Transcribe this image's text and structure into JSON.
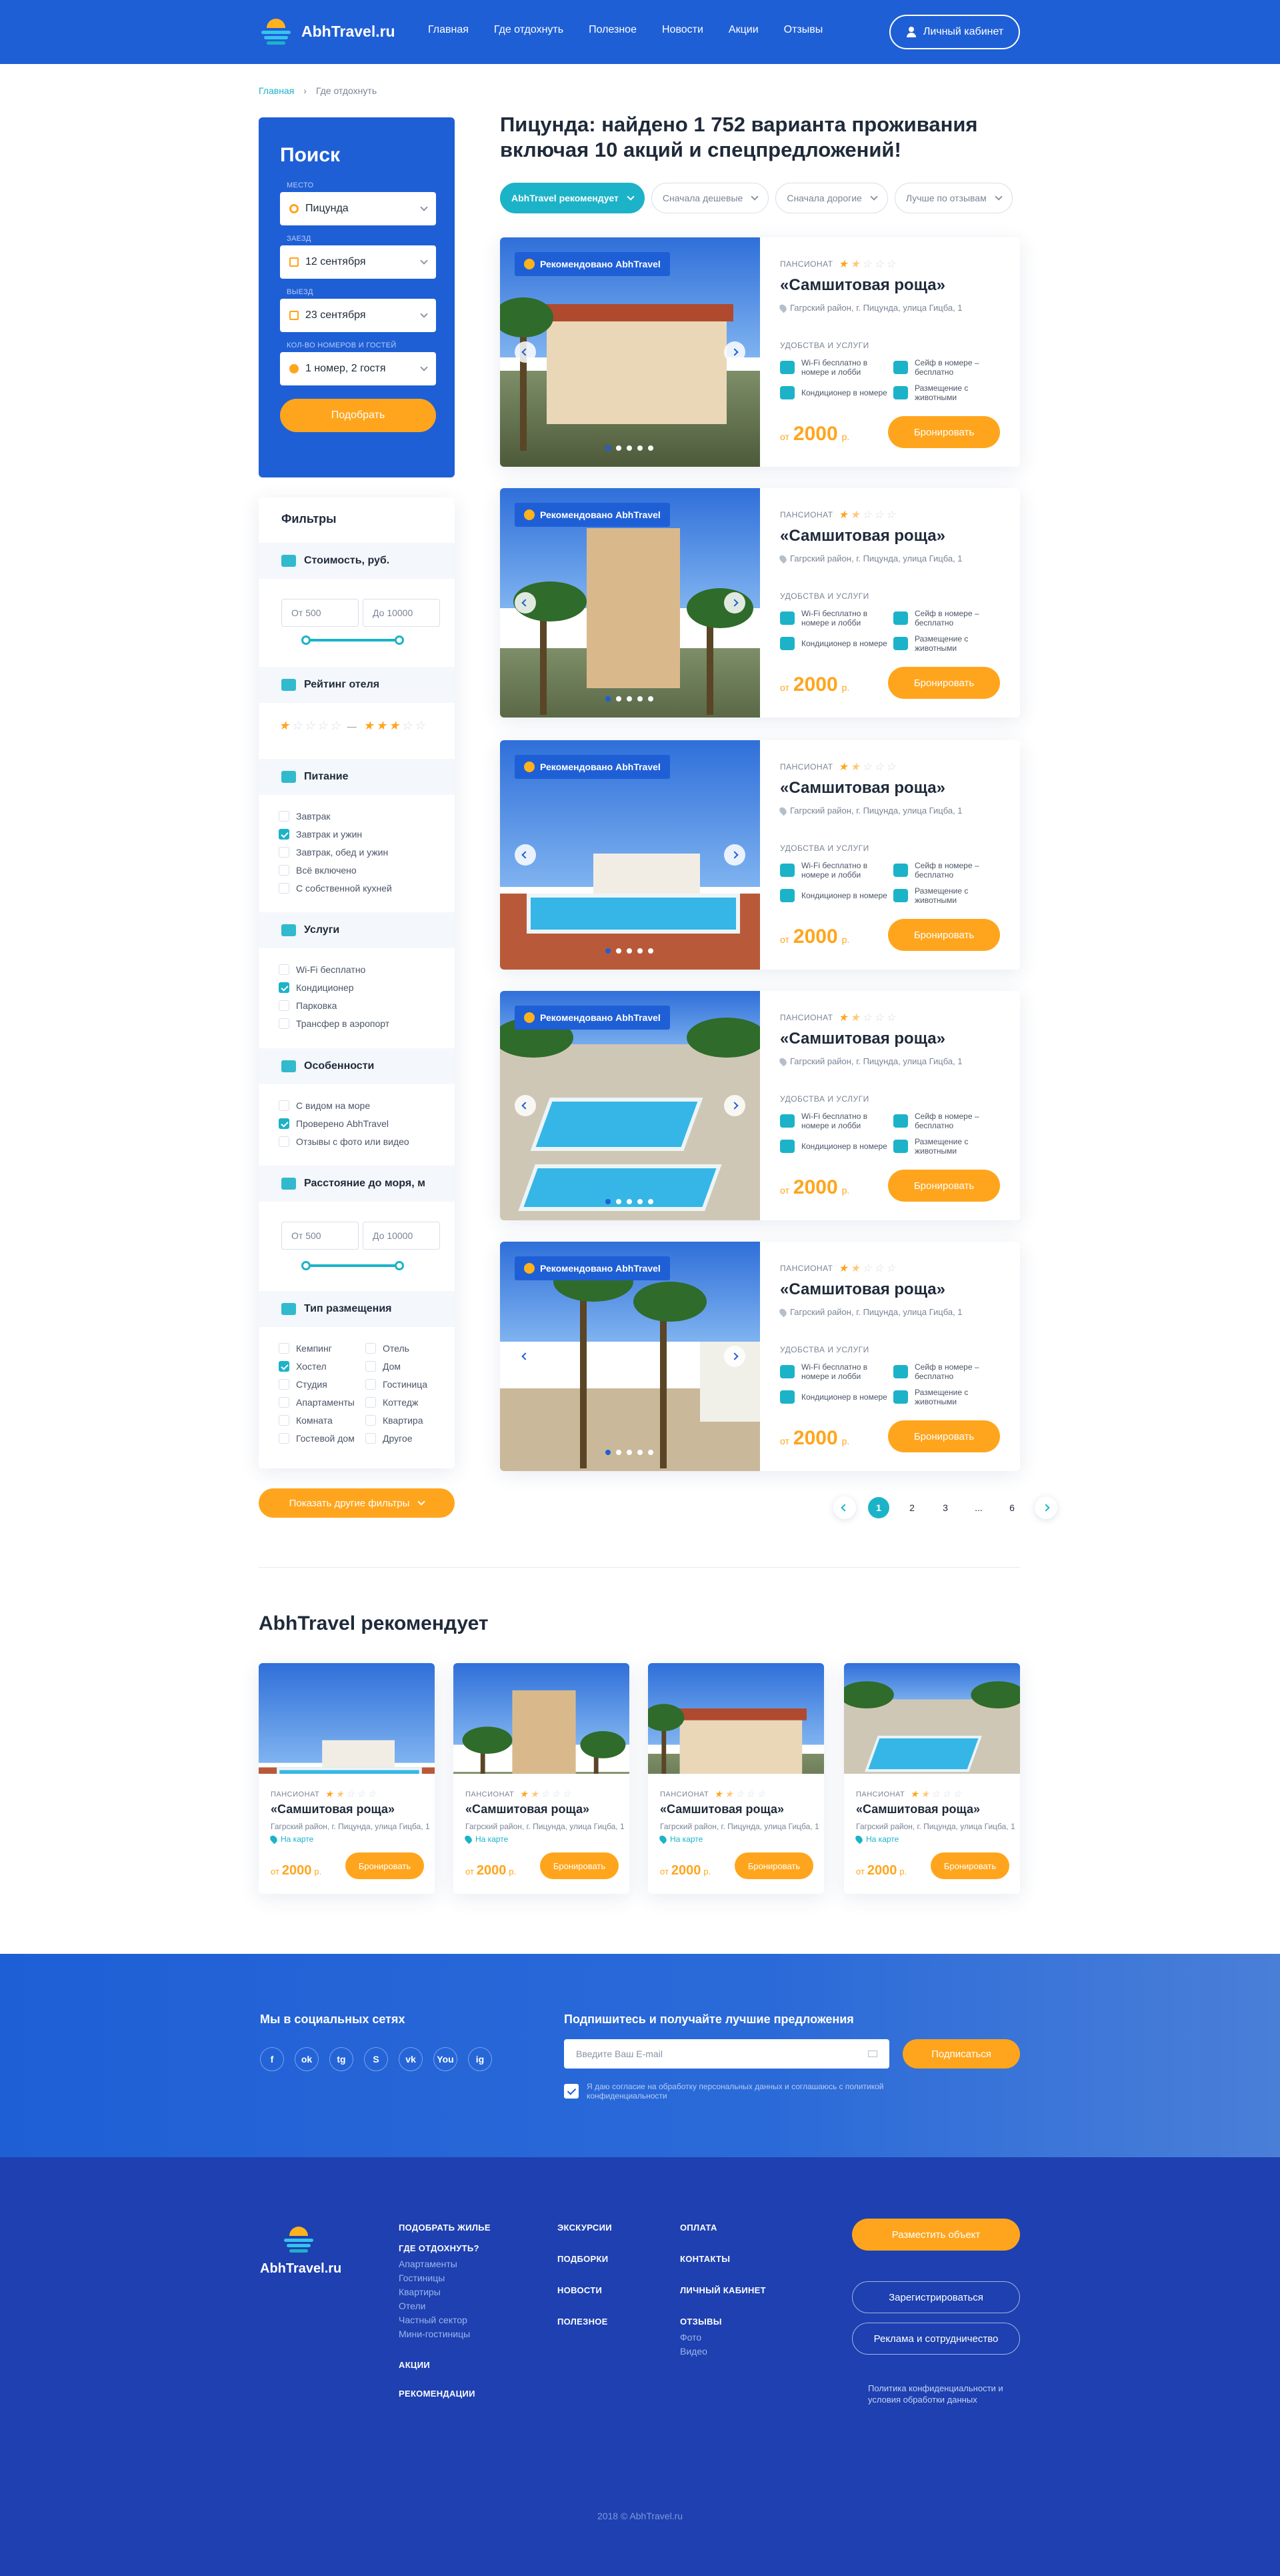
{
  "header": {
    "logo": "AbhTravel.ru",
    "nav": [
      "Главная",
      "Где отдохнуть",
      "Полезное",
      "Новости",
      "Акции",
      "Отзывы"
    ],
    "cabinet": "Личный кабинет"
  },
  "breadcrumb": [
    "Главная",
    "Где отдохнуть"
  ],
  "search": {
    "title": "Поиск",
    "fields": [
      {
        "label": "Место",
        "value": "Пицунда"
      },
      {
        "label": "Заезд",
        "value": "12 сентября"
      },
      {
        "label": "Выезд",
        "value": "23 сентября"
      },
      {
        "label": "Кол-во номеров и гостей",
        "value": "1 номер, 2 гостя"
      }
    ],
    "button": "Подобрать"
  },
  "filters": {
    "title": "Фильтры",
    "cost": {
      "title": "Стоимость, руб.",
      "from": "От 500",
      "to": "До 10000"
    },
    "rating": {
      "title": "Рейтинг отеля",
      "from_stars": 1,
      "to_stars": 3,
      "sep": "—"
    },
    "food": {
      "title": "Питание",
      "options": [
        "Завтрак",
        "Завтрак и ужин",
        "Завтрак, обед и ужин",
        "Всё включено",
        "С собственной кухней"
      ],
      "checked": [
        1
      ]
    },
    "services": {
      "title": "Услуги",
      "options": [
        "Wi-Fi бесплатно",
        "Кондиционер",
        "Парковка",
        "Трансфер в аэропорт"
      ],
      "checked": [
        1
      ]
    },
    "features": {
      "title": "Особенности",
      "options": [
        "С видом на море",
        "Проверено AbhTravel",
        "Отзывы с фото или видео"
      ],
      "checked": [
        1
      ]
    },
    "distance": {
      "title": "Расстояние до моря, м",
      "from": "От 500",
      "to": "До 10000"
    },
    "placement": {
      "title": "Тип размещения",
      "left": [
        "Кемпинг",
        "Хостел",
        "Студия",
        "Апартаменты",
        "Комната",
        "Гостевой дом"
      ],
      "right": [
        "Отель",
        "Дом",
        "Гостиница",
        "Коттедж",
        "Квартира",
        "Другое"
      ],
      "checked_left": [
        1
      ]
    },
    "more": "Показать другие фильтры"
  },
  "results": {
    "title": "Пицунда: найдено 1 752 варианта проживания включая 10 акций и спецпредложений!",
    "sorts": [
      "AbhTravel рекомендует",
      "Сначала дешевые",
      "Сначала дорогие",
      "Лучше по отзывам"
    ],
    "badge": "Рекомендовано AbhTravel",
    "card": {
      "kind": "ПАНСИОНАТ",
      "rating": 1.5,
      "name": "«Самшитовая роща»",
      "address": "Гагрский район, г. Пицунда, улица Гицба, 1",
      "amenities_title": "УДОБСТВА И УСЛУГИ",
      "amenities": [
        "Wi-Fi бесплатно в номере и лобби",
        "Сейф в номере – бесплатно",
        "Кондиционер в номере",
        "Размещение с животными"
      ],
      "price_prefix": "от",
      "price": "2000",
      "currency": "р.",
      "book": "Бронировать"
    }
  },
  "pagination": [
    "1",
    "2",
    "3",
    "...",
    "6"
  ],
  "recommended": {
    "title": "AbhTravel рекомендует",
    "card": {
      "kind": "ПАНСИОНАТ",
      "name": "«Самшитовая роща»",
      "address": "Гагрский район, г. Пицунда, улица Гицба, 1",
      "map": "На карте",
      "price_prefix": "от",
      "price": "2000",
      "currency": "р.",
      "book": "Бронировать"
    }
  },
  "social": {
    "title": "Мы в социальных сетях",
    "icons": [
      "f",
      "ok",
      "tg",
      "S",
      "vk",
      "You",
      "ig"
    ],
    "subscribe_title": "Подпишитесь и получайте лучшие предложения",
    "email_placeholder": "Введите Ваш E-mail",
    "subscribe_button": "Подписаться",
    "agree": "Я даю согласие на обработку персональных данных и соглашаюсь с политикой конфиденциальности"
  },
  "footer": {
    "logo": "AbhTravel.ru",
    "col1": {
      "h1": "ПОДОБРАТЬ ЖИЛЬЕ",
      "h2": "ГДЕ ОТДОХНУТЬ?",
      "items": [
        "Апартаменты",
        "Гостиницы",
        "Квартиры",
        "Отели",
        "Частный сектор",
        "Мини-гостиницы"
      ],
      "h3": "АКЦИИ",
      "h4": "РЕКОМЕНДАЦИИ"
    },
    "col2": [
      "ЭКСКУРСИИ",
      "ПОДБОРКИ",
      "НОВОСТИ",
      "ПОЛЕЗНОЕ"
    ],
    "col3": {
      "items": [
        "ОПЛАТА",
        "КОНТАКТЫ",
        "ЛИЧНЫЙ КАБИНЕТ",
        "ОТЗЫВЫ"
      ],
      "sub": [
        "Фото",
        "Видео"
      ]
    },
    "buttons": [
      "Разместить объект",
      "Зарегистрироваться",
      "Реклама и сотрудничество"
    ],
    "policy": "Политика конфиденциальности и условия обработки данных",
    "copyright": "2018 © AbhTravel.ru"
  },
  "colors": {
    "brand_blue": "#1f5fd6",
    "accent_orange": "#ffa51d",
    "teal": "#1cb3c8",
    "footer_blue": "#1e40b0"
  }
}
